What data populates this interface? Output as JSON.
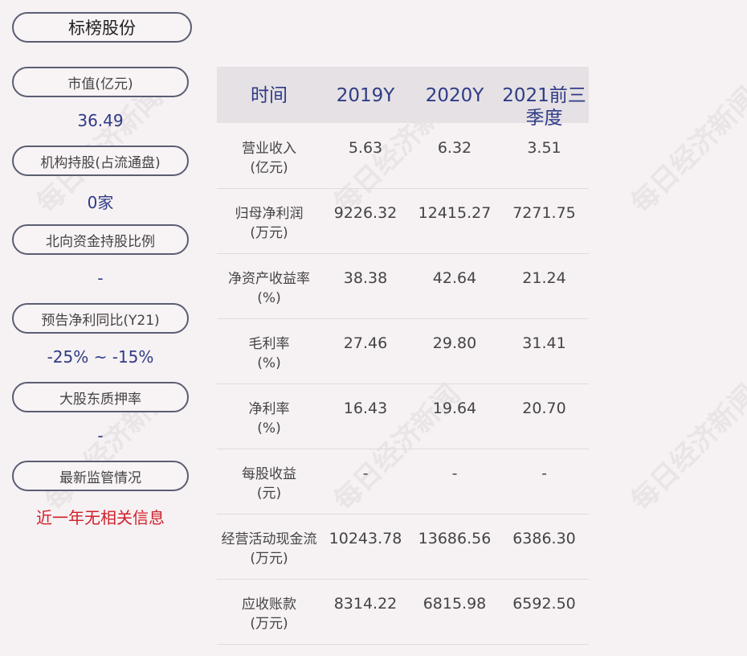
{
  "company": "标榜股份",
  "metrics": [
    {
      "label": "市值(亿元)",
      "value": "36.49"
    },
    {
      "label": "机构持股(占流通盘)",
      "value": "0家"
    },
    {
      "label": "北向资金持股比例",
      "value": "-"
    },
    {
      "label": "预告净利同比(Y21)",
      "value": "-25% ~ -15%"
    },
    {
      "label": "大股东质押率",
      "value": "-"
    },
    {
      "label": "最新监管情况",
      "value": "近一年无相关信息"
    }
  ],
  "table": {
    "headers": [
      "时间",
      "2019Y",
      "2020Y",
      "2021前三季度"
    ],
    "rows": [
      {
        "name": "营业收入",
        "unit": "(亿元)",
        "values": [
          "5.63",
          "6.32",
          "3.51"
        ]
      },
      {
        "name": "归母净利润",
        "unit": "(万元)",
        "values": [
          "9226.32",
          "12415.27",
          "7271.75"
        ]
      },
      {
        "name": "净资产收益率",
        "unit": "(%)",
        "values": [
          "38.38",
          "42.64",
          "21.24"
        ]
      },
      {
        "name": "毛利率",
        "unit": "(%)",
        "values": [
          "27.46",
          "29.80",
          "31.41"
        ]
      },
      {
        "name": "净利率",
        "unit": "(%)",
        "values": [
          "16.43",
          "19.64",
          "20.70"
        ]
      },
      {
        "name": "每股收益",
        "unit": "(元)",
        "values": [
          "-",
          "-",
          "-"
        ]
      },
      {
        "name": "经营活动现金流",
        "unit": "(万元)",
        "values": [
          "10243.78",
          "13686.56",
          "6386.30"
        ]
      },
      {
        "name": "应收账款",
        "unit": "(万元)",
        "values": [
          "8314.22",
          "6815.98",
          "6592.50"
        ]
      }
    ]
  },
  "watermark": "每日经济新闻",
  "colors": {
    "value_blue": "#2e3b86",
    "alert_red": "#d0202a",
    "header_bg": "#e5e1e4",
    "page_bg": "#f6f1f3"
  }
}
